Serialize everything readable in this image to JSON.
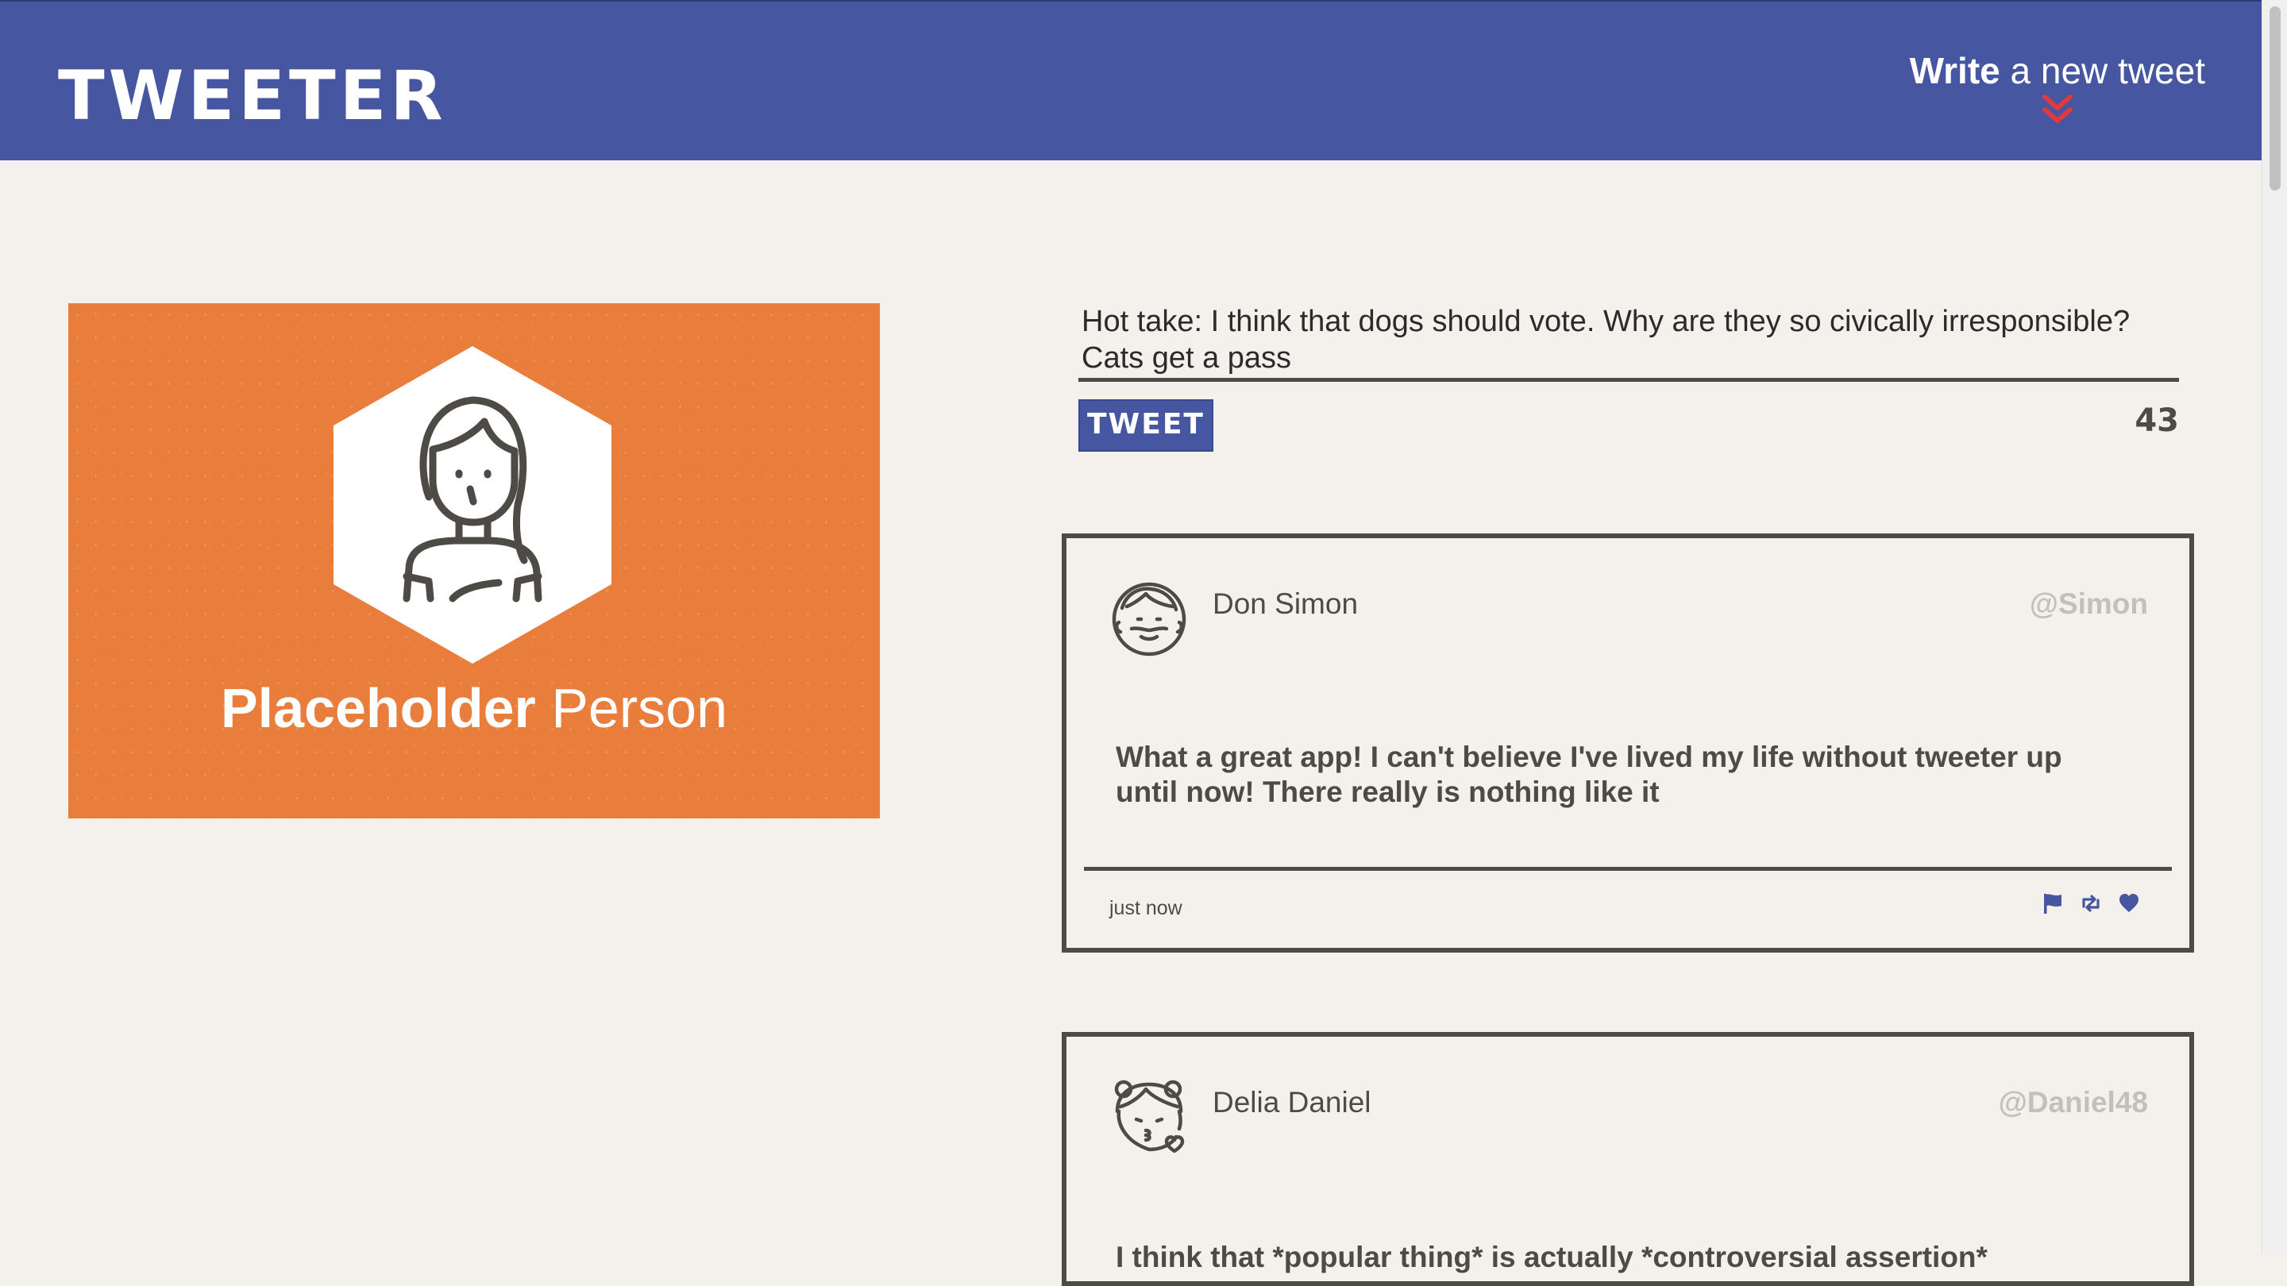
{
  "nav": {
    "brand": "TWEETER",
    "compose_toggle": {
      "strong": "Write",
      "rest": " a new tweet",
      "icon": "double-chevron-down-icon",
      "icon_color": "#e0393e"
    },
    "background": "#4656a0"
  },
  "profile": {
    "first_name": "Placeholder",
    "last_name": " Person",
    "avatar_icon": "woman-avatar-icon",
    "background": "#e97d3b"
  },
  "compose": {
    "text": "Hot take: I think that dogs should vote. Why are they so civically irresponsible? Cats get a pass",
    "button_label": "TWEET",
    "counter": "43"
  },
  "tweets": [
    {
      "author": "Don Simon",
      "handle": "@Simon",
      "avatar_icon": "man-avatar-icon",
      "body": "What a great app! I can't believe I've lived my life without tweeter up until now! There really is nothing like it",
      "time": "just now",
      "actions": [
        "flag-icon",
        "retweet-icon",
        "heart-icon"
      ]
    },
    {
      "author": "Delia Daniel",
      "handle": "@Daniel48",
      "avatar_icon": "girl-avatar-icon",
      "body": "I think that *popular thing* is actually *controversial assertion*"
    }
  ],
  "colors": {
    "page_background": "#f4f1ec",
    "text": "#4e4a46",
    "handle": "#c3c0bb",
    "accent": "#4656a0"
  }
}
